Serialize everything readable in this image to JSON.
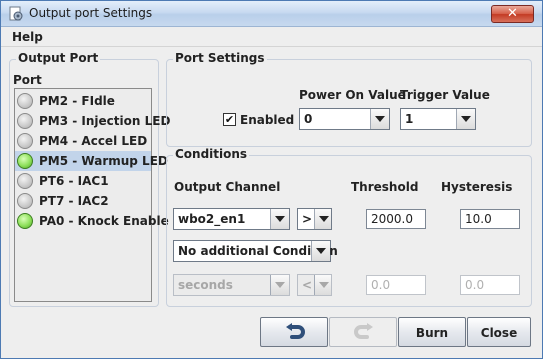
{
  "window": {
    "title": "Output port Settings",
    "close_glyph": "✕"
  },
  "menu": {
    "help": "Help"
  },
  "output_port": {
    "group_title": "Output Port",
    "port_label": "Port",
    "ports": [
      {
        "name": "PM2 - FIdle",
        "active": false,
        "selected": false
      },
      {
        "name": "PM3 - Injection LED",
        "active": false,
        "selected": false
      },
      {
        "name": "PM4 - Accel LED",
        "active": false,
        "selected": false
      },
      {
        "name": "PM5 - Warmup LED",
        "active": true,
        "selected": true
      },
      {
        "name": "PT6 - IAC1",
        "active": false,
        "selected": false
      },
      {
        "name": "PT7 - IAC2",
        "active": false,
        "selected": false
      },
      {
        "name": "PA0 - Knock Enable",
        "active": true,
        "selected": false
      }
    ]
  },
  "port_settings": {
    "group_title": "Port Settings",
    "enabled_label": "Enabled",
    "enabled_checked": true,
    "check_glyph": "✔",
    "power_on_label": "Power On Value",
    "power_on_value": "0",
    "trigger_label": "Trigger Value",
    "trigger_value": "1"
  },
  "conditions": {
    "group_title": "Conditions",
    "output_channel_label": "Output Channel",
    "threshold_label": "Threshold",
    "hysteresis_label": "Hysteresis",
    "row1": {
      "channel": "wbo2_en1",
      "operator": ">",
      "threshold": "2000.0",
      "hysteresis": "10.0"
    },
    "additional_condition": "No additional Condition",
    "row2": {
      "channel": "seconds",
      "operator": "<",
      "threshold": "0.0",
      "hysteresis": "0.0",
      "disabled": true
    }
  },
  "buttons": {
    "undo_icon": "undo-arrow-icon",
    "redo_icon": "redo-arrow-icon",
    "burn": "Burn",
    "close": "Close"
  },
  "colors": {
    "active_led": "#8fe05c",
    "selected_row": "#c2d4ea",
    "title_close": "#c33b24"
  }
}
